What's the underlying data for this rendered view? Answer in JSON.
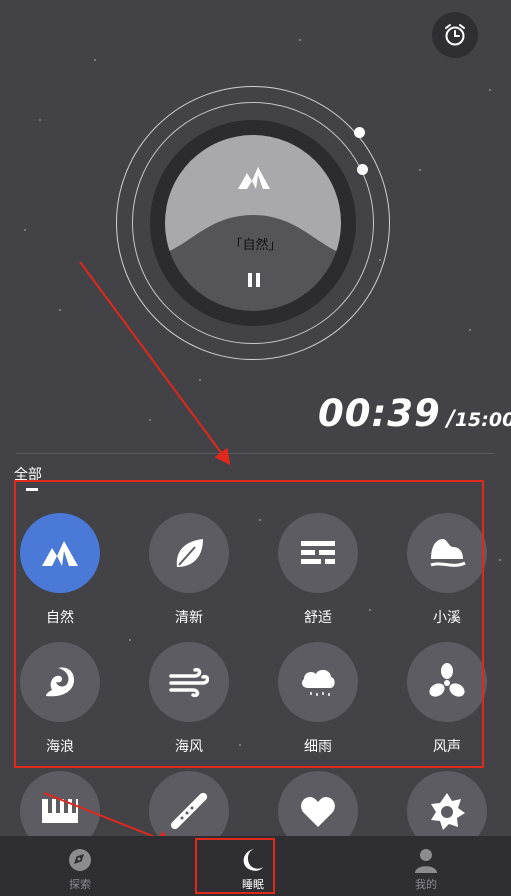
{
  "player": {
    "scene_label": "「自然」",
    "state": "playing"
  },
  "timer": {
    "current": "00:39",
    "separator": "/",
    "total": "15:00"
  },
  "category": {
    "label": "全部"
  },
  "sounds": [
    {
      "label": "自然",
      "icon": "mountain-icon",
      "active": true
    },
    {
      "label": "清新",
      "icon": "leaf-icon",
      "active": false
    },
    {
      "label": "舒适",
      "icon": "lines-icon",
      "active": false
    },
    {
      "label": "小溪",
      "icon": "stream-icon",
      "active": false
    },
    {
      "label": "海浪",
      "icon": "wave-icon",
      "active": false
    },
    {
      "label": "海风",
      "icon": "wind-icon",
      "active": false
    },
    {
      "label": "细雨",
      "icon": "rain-cloud-icon",
      "active": false
    },
    {
      "label": "风声",
      "icon": "fan-icon",
      "active": false
    }
  ],
  "partial_row_icons": [
    "piano-icon",
    "flute-icon",
    "heart-icon",
    "gear-sun-icon"
  ],
  "bottom_nav": [
    {
      "label": "探索",
      "icon": "compass-icon",
      "active": false
    },
    {
      "label": "睡眠",
      "icon": "moon-icon",
      "active": true
    },
    {
      "label": "我的",
      "icon": "profile-icon",
      "active": false
    }
  ],
  "colors": {
    "background": "#434247",
    "accent": "#4a79d8",
    "annotation": "#e0281c"
  }
}
